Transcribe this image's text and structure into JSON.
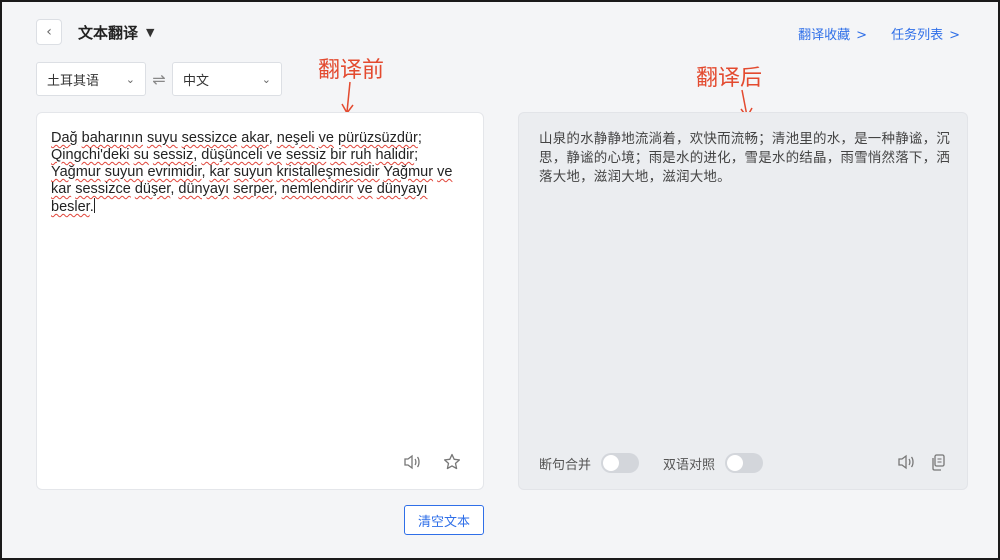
{
  "header": {
    "title": "文本翻译",
    "links": [
      {
        "label": "翻译收藏",
        "chevron": ">"
      },
      {
        "label": "任务列表",
        "chevron": ">"
      }
    ]
  },
  "languages": {
    "source": "土耳其语",
    "target": "中文"
  },
  "annotations": {
    "before": "翻译前",
    "after": "翻译后"
  },
  "source_words": [
    "Dağ",
    " ",
    "baharının",
    " ",
    "suyu",
    " ",
    "sessizce",
    " ",
    "akar",
    ", ",
    "neşeli",
    " ",
    "ve",
    " ",
    "pürüzsüzdür",
    "; ",
    "Qingchi'deki",
    " ",
    "su",
    " ",
    "sessiz",
    ", ",
    "düşünceli",
    " ",
    "ve",
    " ",
    "sessiz",
    " ",
    "bir",
    " ",
    "ruh",
    " ",
    "halidir",
    "; ",
    "Yağmur",
    " ",
    "suyun",
    " ",
    "evrimidir",
    ", ",
    "kar",
    " ",
    "suyun",
    " ",
    "kristalleşmesidir",
    " ",
    "Yağmur",
    " ",
    "ve",
    " ",
    "kar",
    " ",
    "sessizce",
    " ",
    "düşer",
    ", ",
    "dünyayı",
    " ",
    "serper",
    ", ",
    "nemlendirir",
    " ",
    "ve",
    " ",
    "dünyayı",
    " ",
    "besler",
    "."
  ],
  "target_text": "山泉的水静静地流淌着，欢快而流畅；清池里的水，是一种静谧，沉思，静谧的心境；雨是水的进化，雪是水的结晶，雨雪悄然落下，洒落大地，滋润大地，滋润大地。",
  "toggles": {
    "sentence_merge": "断句合并",
    "bilingual": "双语对照"
  },
  "clear_button": "清空文本"
}
